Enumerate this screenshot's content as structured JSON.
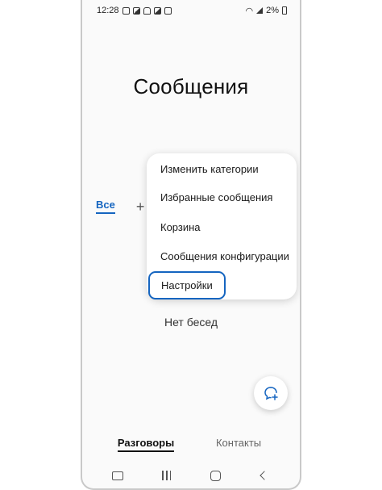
{
  "status_bar": {
    "time": "12:28",
    "battery": "2%"
  },
  "header": {
    "title": "Сообщения"
  },
  "category_tabs": {
    "all": "Все",
    "add_icon": "plus-icon"
  },
  "menu": {
    "items": [
      {
        "label": "Изменить категории"
      },
      {
        "label": "Избранные сообщения"
      },
      {
        "label": "Корзина"
      },
      {
        "label": "Сообщения конфигурации"
      },
      {
        "label": "Настройки",
        "highlighted": true
      }
    ]
  },
  "main": {
    "empty_text": "Нет бесед"
  },
  "fab": {
    "icon": "new-chat-icon"
  },
  "bottom_tabs": {
    "conversations": "Разговоры",
    "contacts": "Контакты",
    "active": "Разговоры"
  },
  "nav_bar": {
    "icons": [
      "recents-icon",
      "home-icon",
      "back-icon"
    ]
  },
  "colors": {
    "accent": "#1565c0",
    "background": "#fafafa",
    "text": "#1a1a1a"
  }
}
